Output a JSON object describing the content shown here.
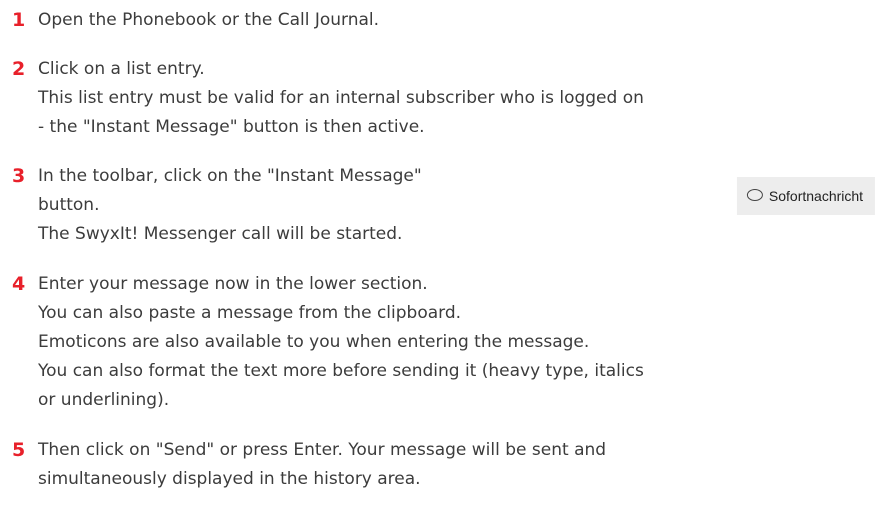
{
  "accent_color": "#e8202a",
  "steps": [
    {
      "number": "1",
      "lines": [
        "Open the Phonebook or the Call Journal."
      ]
    },
    {
      "number": "2",
      "lines": [
        "Click on a list entry.",
        "This list entry must be valid for an internal subscriber who is logged on",
        "- the \"Instant Message\" button is then active."
      ]
    },
    {
      "number": "3",
      "lines": [
        "In the toolbar, click on the \"Instant Message\"",
        "button.",
        "The SwyxIt! Messenger call will be started."
      ]
    },
    {
      "number": "4",
      "lines": [
        "Enter your message now in the lower section.",
        "You can also paste a message from the clipboard.",
        "Emoticons are also available to you when entering the message.",
        "You can also format the text more before sending it (heavy type, italics",
        "or underlining)."
      ]
    },
    {
      "number": "5",
      "lines": [
        "Then click on \"Send\" or press Enter. Your message will be sent and",
        "simultaneously displayed in the history area."
      ]
    }
  ],
  "toolbar_button": {
    "icon": "speech-bubble-icon",
    "label": "Sofortnachricht"
  }
}
